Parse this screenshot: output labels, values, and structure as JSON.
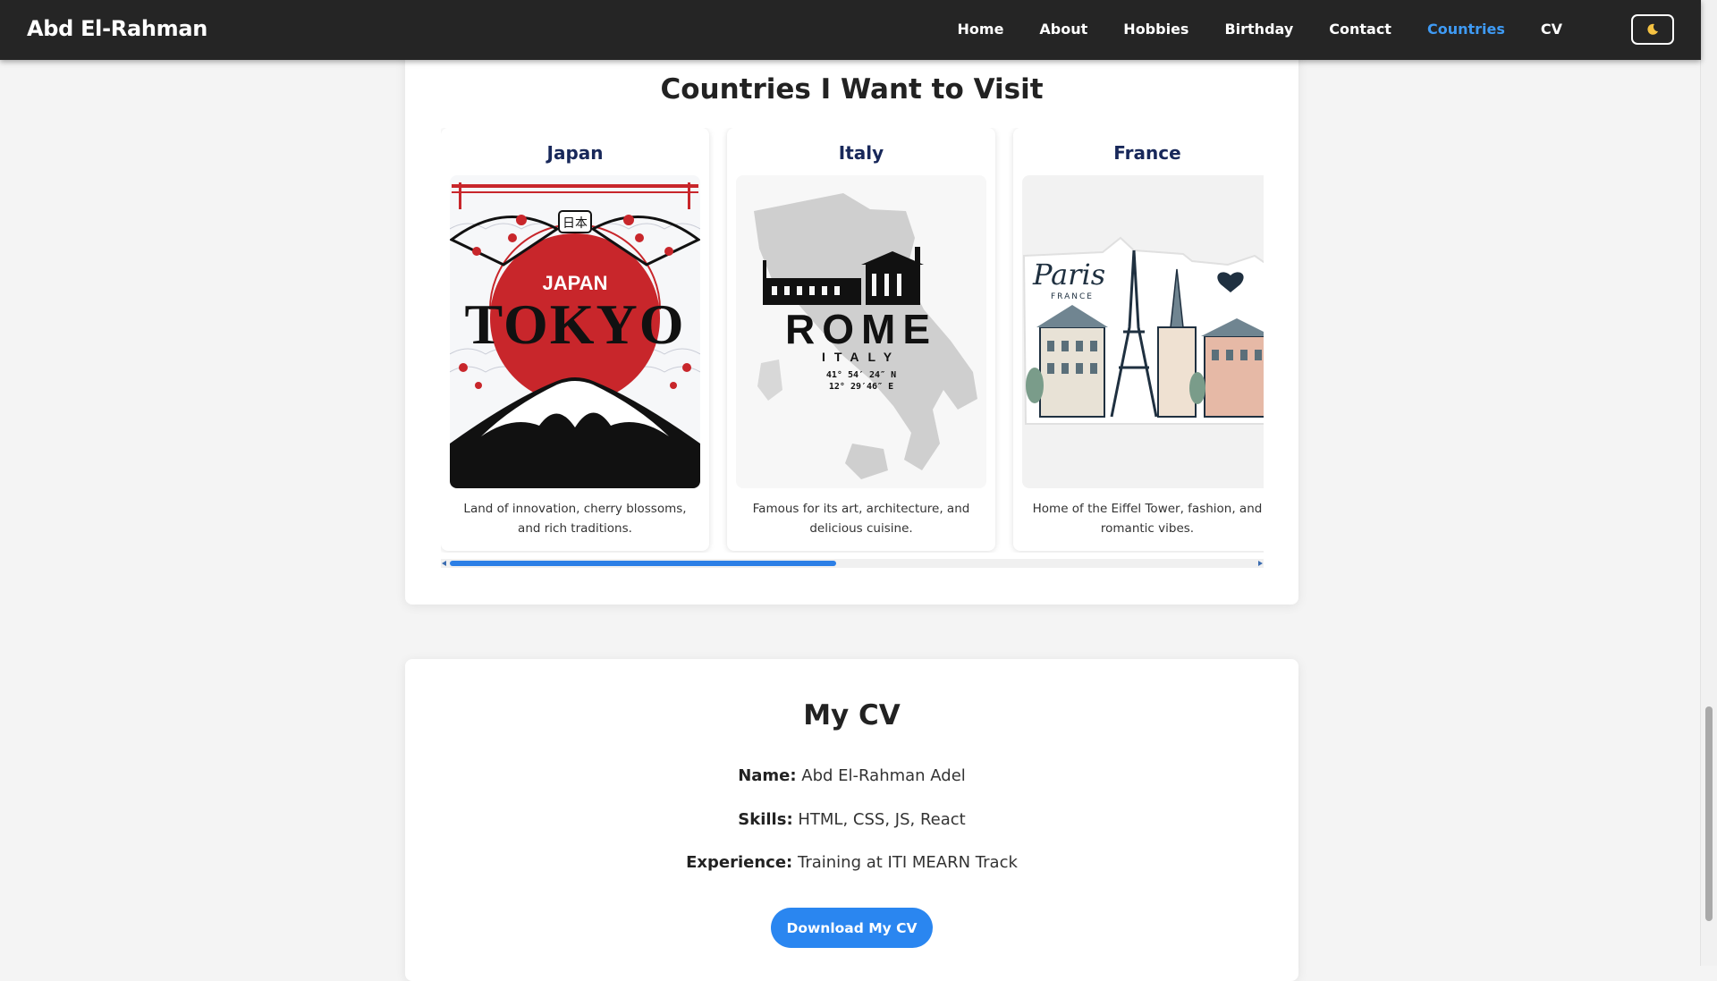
{
  "brand": "Abd El-Rahman",
  "nav": {
    "items": [
      {
        "label": "Home"
      },
      {
        "label": "About"
      },
      {
        "label": "Hobbies"
      },
      {
        "label": "Birthday"
      },
      {
        "label": "Contact"
      },
      {
        "label": "Countries"
      },
      {
        "label": "CV"
      }
    ],
    "active": "Countries",
    "theme_toggle_icon": "moon-icon"
  },
  "countries": {
    "title": "Countries I Want to Visit",
    "carousel_progress": 0.48,
    "cards": [
      {
        "name": "Japan",
        "description": "Land of innovation, cherry blossoms, and rich traditions.",
        "image_label": "JAPAN"
      },
      {
        "name": "Italy",
        "description": "Famous for its art, architecture, and delicious cuisine.",
        "image_label": "ROME"
      },
      {
        "name": "France",
        "description": "Home of the Eiffel Tower, fashion, and romantic vibes.",
        "image_label": "Paris"
      }
    ]
  },
  "cv": {
    "title": "My CV",
    "name_label": "Name:",
    "name_value": "Abd El-Rahman Adel",
    "skills_label": "Skills:",
    "skills_value": "HTML, CSS, JS, React",
    "experience_label": "Experience:",
    "experience_value": "Training at ITI MEARN Track",
    "download_label": "Download My CV"
  },
  "colors": {
    "navbar": "#252525",
    "active_link": "#3f9bf5",
    "accent": "#2a86f0",
    "country_name": "#18285a",
    "japan_red": "#c8262b"
  }
}
